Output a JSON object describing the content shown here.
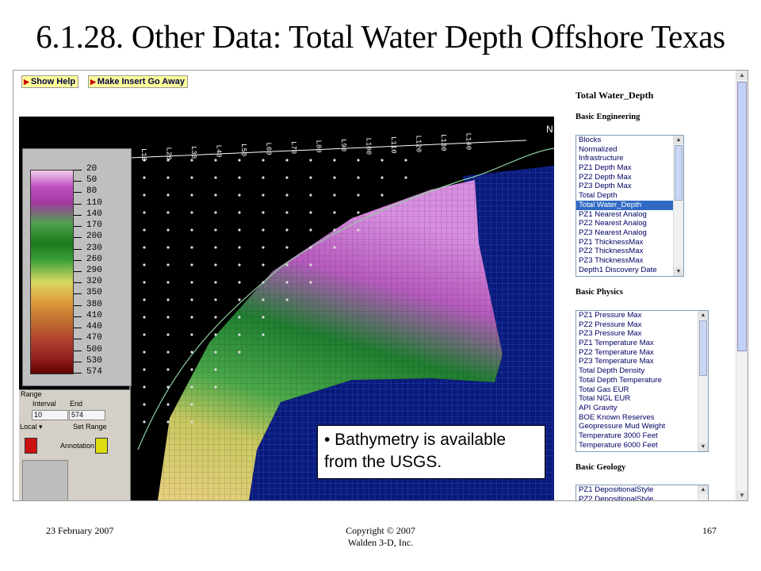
{
  "slide": {
    "title": "6.1.28. Other Data: Total Water Depth Offshore Texas",
    "footer_date": "23 February 2007",
    "footer_copyright_1": "Copyright © 2007",
    "footer_copyright_2": "Walden 3-D, Inc.",
    "footer_page": "167"
  },
  "toolbar": {
    "show_help": "Show Help",
    "make_insert": "Make Insert Go Away"
  },
  "legend": {
    "labels": [
      "20",
      "50",
      "80",
      "110",
      "140",
      "170",
      "200",
      "230",
      "260",
      "290",
      "320",
      "350",
      "380",
      "410",
      "440",
      "470",
      "500",
      "530",
      "574"
    ]
  },
  "controls": {
    "range": "Range",
    "interval_label": "Interval",
    "end_label": "End",
    "interval_value": "10",
    "end_value": "574",
    "local": "Local",
    "set_range": "Set Range",
    "annotation": "Annotation",
    "color_local": "#cc1111",
    "color_annotation": "#dddd11"
  },
  "overlay": {
    "line1": "• Bathymetry is available",
    "line2": "from the USGS."
  },
  "map": {
    "columns": [
      "L10",
      "L20",
      "L30",
      "L40",
      "L50",
      "L60",
      "L70",
      "L80",
      "L90",
      "L100",
      "L110",
      "L120",
      "L130",
      "L140"
    ],
    "north_label": "N"
  },
  "panel": {
    "title": "Total Water_Depth",
    "basic_engineering": {
      "heading": "Basic Engineering",
      "items": [
        "Blocks",
        "Normalized",
        "Infrastructure",
        "PZ1 Depth Max",
        "PZ2 Depth Max",
        "PZ3 Depth Max",
        "Total Depth",
        "Total Water_Depth",
        "PZ1 Nearest Analog",
        "PZ2 Nearest Analog",
        "PZ3 Nearest Analog",
        "PZ1 ThicknessMax",
        "PZ2 ThicknessMax",
        "PZ3 ThicknessMax",
        "Depth1 Discovery Date"
      ],
      "selected": "Total Water_Depth"
    },
    "basic_physics": {
      "heading": "Basic Physics",
      "items": [
        "PZ1 Pressure Max",
        "PZ2 Pressure Max",
        "PZ3 Pressure Max",
        "PZ1 Temperature Max",
        "PZ2 Temperature Max",
        "PZ3 Temperature Max",
        "Total Depth Density",
        "Total Depth Temperature",
        "Total Gas EUR",
        "Total NGL EUR",
        "API Gravity",
        "BOE Known Reserves",
        "Geopressure Mud Weight",
        "Temperature 3000 Feet",
        "Temperature 6000 Feet"
      ]
    },
    "basic_geology": {
      "heading": "Basic Geology",
      "items": [
        "PZ1 DepositionalStyle",
        "PZ2 DepositionalStyle"
      ]
    }
  },
  "colors": {
    "selection": "#316ac5",
    "button_bg": "#ffff99",
    "link_text": "#000066"
  }
}
